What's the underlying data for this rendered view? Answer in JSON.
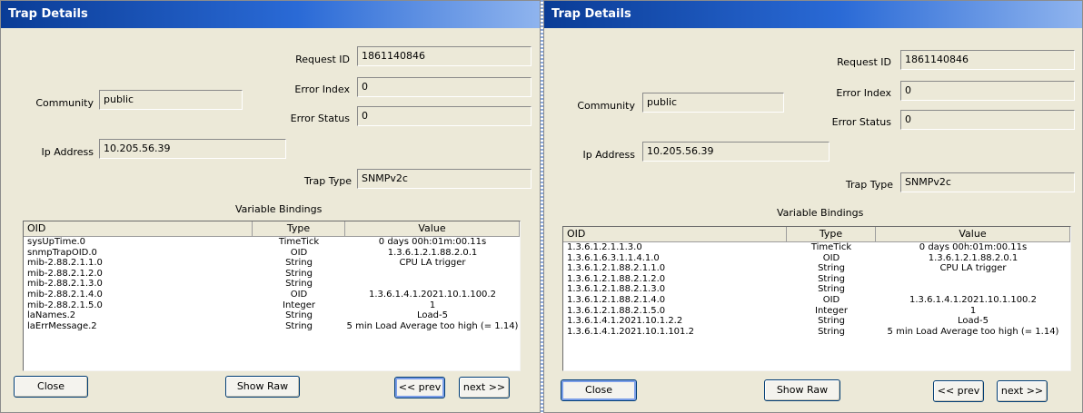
{
  "dialogs": [
    {
      "title": "Trap Details",
      "labels": {
        "request_id": "Request ID",
        "error_index": "Error Index",
        "error_status": "Error Status",
        "community": "Community",
        "ip_address": "Ip Address",
        "trap_type": "Trap Type",
        "variable_bindings": "Variable Bindings"
      },
      "values": {
        "request_id": "1861140846",
        "error_index": "0",
        "error_status": "0",
        "community": "public",
        "ip_address": "10.205.56.39",
        "trap_type": "SNMPv2c"
      },
      "table": {
        "headers": [
          "OID",
          "Type",
          "Value"
        ],
        "rows": [
          [
            "sysUpTime.0",
            "TimeTick",
            "0 days 00h:01m:00.11s"
          ],
          [
            "snmpTrapOID.0",
            "OID",
            "1.3.6.1.2.1.88.2.0.1"
          ],
          [
            "mib-2.88.2.1.1.0",
            "String",
            "CPU LA trigger"
          ],
          [
            "mib-2.88.2.1.2.0",
            "String",
            ""
          ],
          [
            "mib-2.88.2.1.3.0",
            "String",
            ""
          ],
          [
            "mib-2.88.2.1.4.0",
            "OID",
            "1.3.6.1.4.1.2021.10.1.100.2"
          ],
          [
            "mib-2.88.2.1.5.0",
            "Integer",
            "1"
          ],
          [
            "laNames.2",
            "String",
            "Load-5"
          ],
          [
            "laErrMessage.2",
            "String",
            "5 min Load Average too high (= 1.14)"
          ]
        ]
      },
      "buttons": {
        "close": "Close",
        "show_raw": "Show Raw",
        "prev": "<< prev",
        "next": "next >>"
      }
    },
    {
      "title": "Trap Details",
      "labels": {
        "request_id": "Request ID",
        "error_index": "Error Index",
        "error_status": "Error Status",
        "community": "Community",
        "ip_address": "Ip Address",
        "trap_type": "Trap Type",
        "variable_bindings": "Variable Bindings"
      },
      "values": {
        "request_id": "1861140846",
        "error_index": "0",
        "error_status": "0",
        "community": "public",
        "ip_address": "10.205.56.39",
        "trap_type": "SNMPv2c"
      },
      "table": {
        "headers": [
          "OID",
          "Type",
          "Value"
        ],
        "rows": [
          [
            "1.3.6.1.2.1.1.3.0",
            "TimeTick",
            "0 days 00h:01m:00.11s"
          ],
          [
            "1.3.6.1.6.3.1.1.4.1.0",
            "OID",
            "1.3.6.1.2.1.88.2.0.1"
          ],
          [
            "1.3.6.1.2.1.88.2.1.1.0",
            "String",
            "CPU LA trigger"
          ],
          [
            "1.3.6.1.2.1.88.2.1.2.0",
            "String",
            ""
          ],
          [
            "1.3.6.1.2.1.88.2.1.3.0",
            "String",
            ""
          ],
          [
            "1.3.6.1.2.1.88.2.1.4.0",
            "OID",
            "1.3.6.1.4.1.2021.10.1.100.2"
          ],
          [
            "1.3.6.1.2.1.88.2.1.5.0",
            "Integer",
            "1"
          ],
          [
            "1.3.6.1.4.1.2021.10.1.2.2",
            "String",
            "Load-5"
          ],
          [
            "1.3.6.1.4.1.2021.10.1.101.2",
            "String",
            "5 min Load Average too high (= 1.14)"
          ]
        ]
      },
      "buttons": {
        "close": "Close",
        "show_raw": "Show Raw",
        "prev": "<< prev",
        "next": "next >>"
      }
    }
  ],
  "colors": {
    "title_bar_start": "#0a3c96",
    "title_bar_end": "#8fb4ee",
    "dialog_background": "#ece9d8",
    "button_border": "#003c74"
  }
}
